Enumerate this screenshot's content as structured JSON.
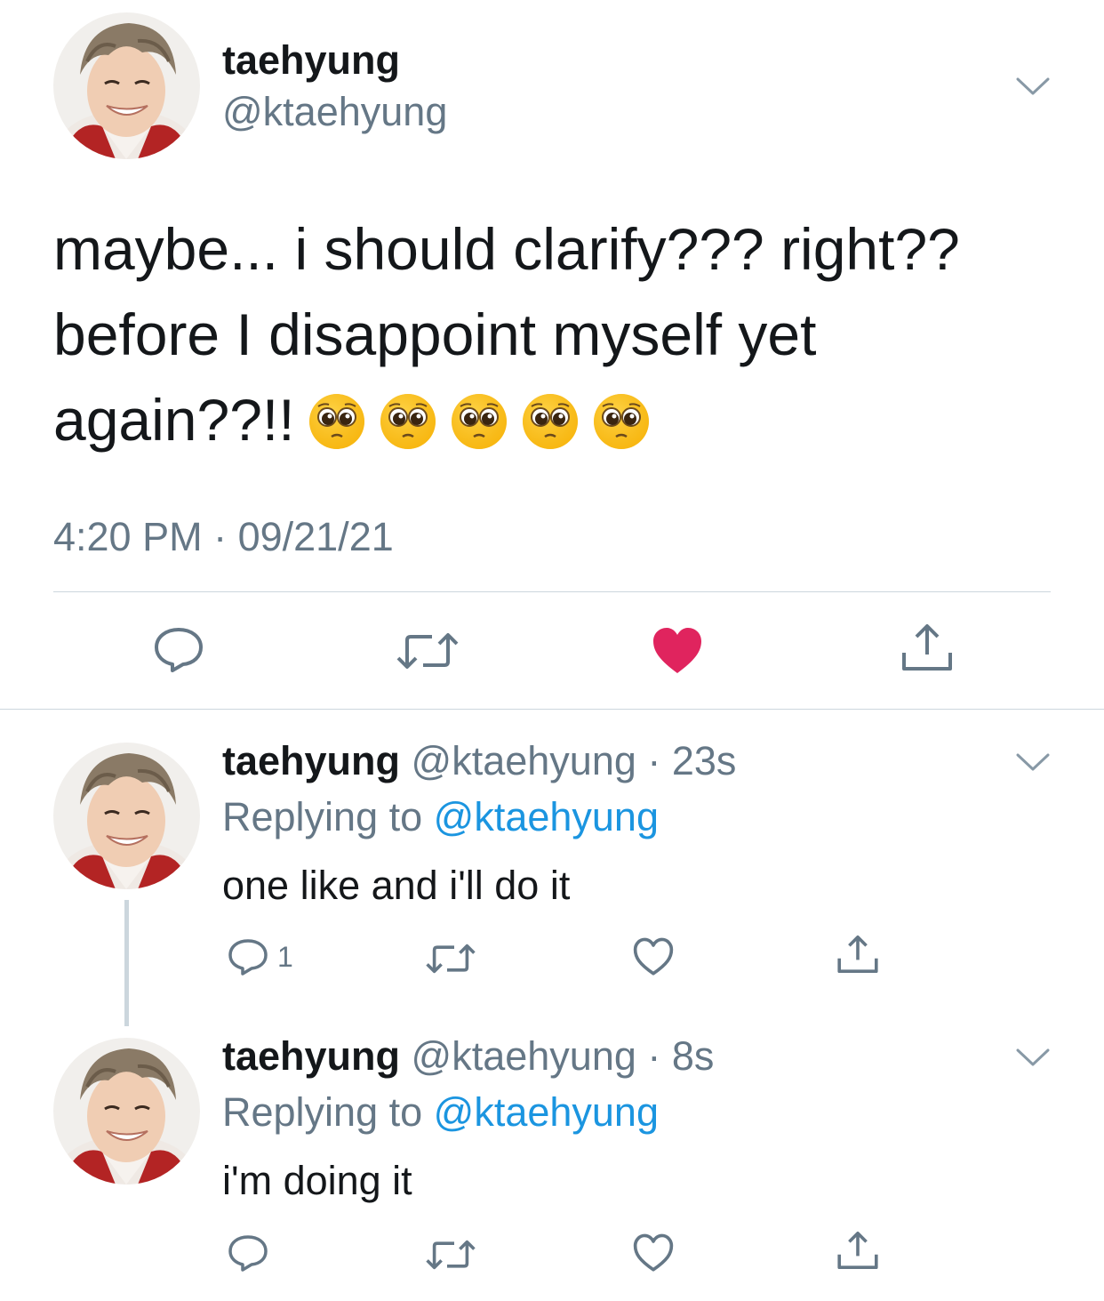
{
  "main_tweet": {
    "name": "taehyung",
    "handle": "@ktaehyung",
    "text": "maybe... i should clarify??? right?? before I disappoint myself yet again??!!",
    "emoji_count": 5,
    "emoji": "pleading-face-emoji",
    "timestamp": "4:20 PM · 09/21/21",
    "liked": true
  },
  "replies": [
    {
      "name": "taehyung",
      "handle_time": "@ktaehyung · 23s",
      "replying_prefix": "Replying to ",
      "replying_to": "@ktaehyung",
      "text": "one like and i'll do it",
      "reply_count": "1",
      "liked": false
    },
    {
      "name": "taehyung",
      "handle_time": "@ktaehyung · 8s",
      "replying_prefix": "Replying to ",
      "replying_to": "@ktaehyung",
      "text": "i'm doing it",
      "reply_count": "",
      "liked": false
    }
  ],
  "colors": {
    "text": "#14171a",
    "secondary": "#657786",
    "link": "#1b95e0",
    "like": "#e0245e",
    "divider": "#ccd6dd"
  },
  "icons": {
    "reply": "reply-icon",
    "retweet": "retweet-icon",
    "like": "heart-icon",
    "share": "share-icon",
    "more": "chevron-down-icon"
  }
}
